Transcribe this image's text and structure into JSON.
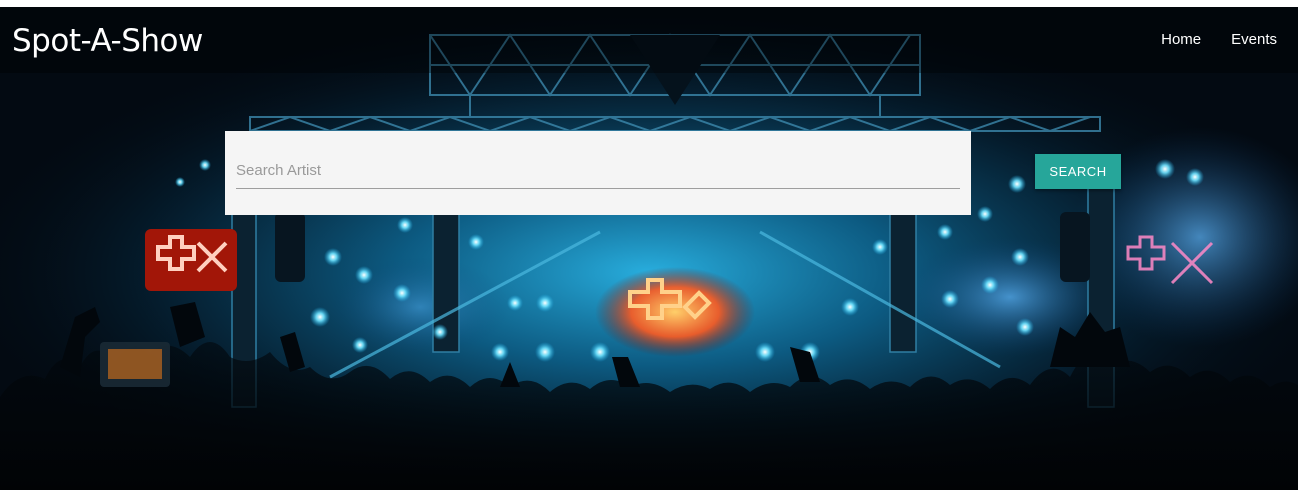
{
  "navbar": {
    "brand": "Spot-A-Show",
    "links": [
      {
        "label": "Home"
      },
      {
        "label": "Events"
      }
    ]
  },
  "search": {
    "placeholder": "Search Artist",
    "value": "",
    "button_label": "SEARCH"
  },
  "hero": {
    "background_description_icon": "concert-stage-image",
    "colors": {
      "stage_light": "#3fd2ff",
      "logo_red": "#ff3a20",
      "button": "#26a69a"
    }
  }
}
